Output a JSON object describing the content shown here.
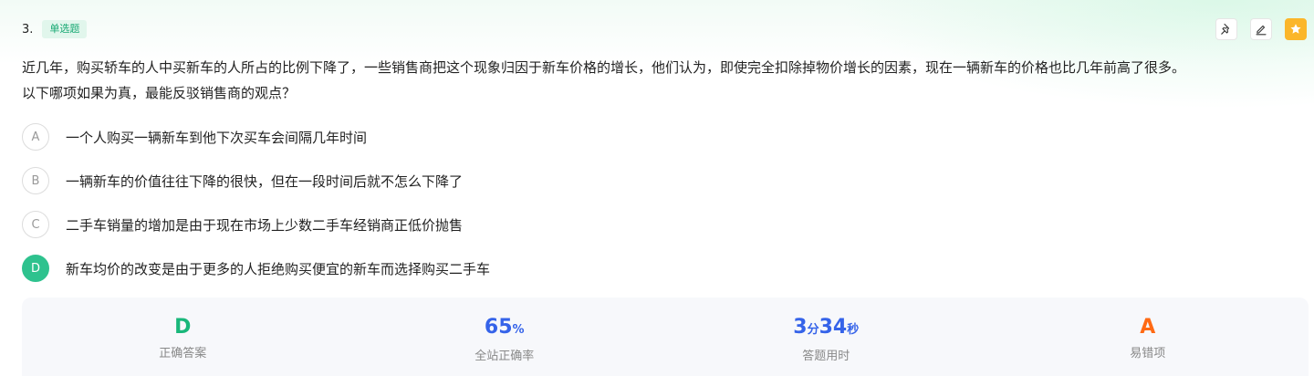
{
  "question": {
    "number": "3.",
    "type": "单选题",
    "stem_line1": "近几年，购买轿车的人中买新车的人所占的比例下降了，一些销售商把这个现象归因于新车价格的增长，他们认为，即使完全扣除掉物价增长的因素，现在一辆新车的价格也比几年前高了很多。",
    "stem_line2": "以下哪项如果为真，最能反驳销售商的观点？"
  },
  "options": [
    {
      "letter": "A",
      "text": "一个人购买一辆新车到他下次买车会间隔几年时间"
    },
    {
      "letter": "B",
      "text": "一辆新车的价值往往下降的很快，但在一段时间后就不怎么下降了"
    },
    {
      "letter": "C",
      "text": "二手车销量的增加是由于现在市场上少数二手车经销商正低价抛售"
    },
    {
      "letter": "D",
      "text": "新车均价的改变是由于更多的人拒绝购买便宜的新车而选择购买二手车"
    }
  ],
  "stats": {
    "correct_answer": {
      "value": "D",
      "label": "正确答案",
      "color": "#19b77a"
    },
    "accuracy": {
      "value": "65",
      "unit": "%",
      "label": "全站正确率",
      "color": "#3563e9"
    },
    "time": {
      "min": "3",
      "min_unit": "分",
      "sec": "34",
      "sec_unit": "秒",
      "label": "答题用时",
      "color": "#3563e9"
    },
    "common_wrong": {
      "value": "A",
      "label": "易错项",
      "color": "#ff6a14"
    }
  },
  "icons": {
    "pin": "pin-icon",
    "edit": "edit-icon",
    "star": "star-icon"
  }
}
